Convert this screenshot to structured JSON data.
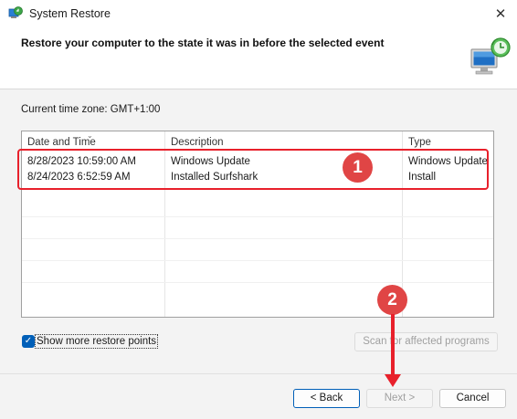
{
  "window": {
    "title": "System Restore",
    "close_glyph": "✕"
  },
  "header": {
    "heading": "Restore your computer to the state it was in before the selected event"
  },
  "content": {
    "timezone": "Current time zone: GMT+1:00",
    "table": {
      "columns": [
        "Date and Time",
        "Description",
        "Type"
      ],
      "rows": [
        {
          "date": "8/28/2023 10:59:00 AM",
          "description": "Windows Update",
          "type": "Windows Update"
        },
        {
          "date": "8/24/2023 6:52:59 AM",
          "description": "Installed Surfshark",
          "type": "Install"
        }
      ]
    },
    "show_more_label": "Show more restore points",
    "show_more_checked": true,
    "scan_button": "Scan for affected programs"
  },
  "footer": {
    "back_button": "< Back",
    "next_button": "Next >",
    "cancel_button": "Cancel"
  },
  "annotations": {
    "badge_1": "1",
    "badge_2": "2",
    "color": "#e8202b"
  },
  "icons": {
    "title_icon": "system-restore-icon",
    "header_art": "computer-restore-icon",
    "close": "close-icon",
    "check": "checkmark-icon"
  }
}
